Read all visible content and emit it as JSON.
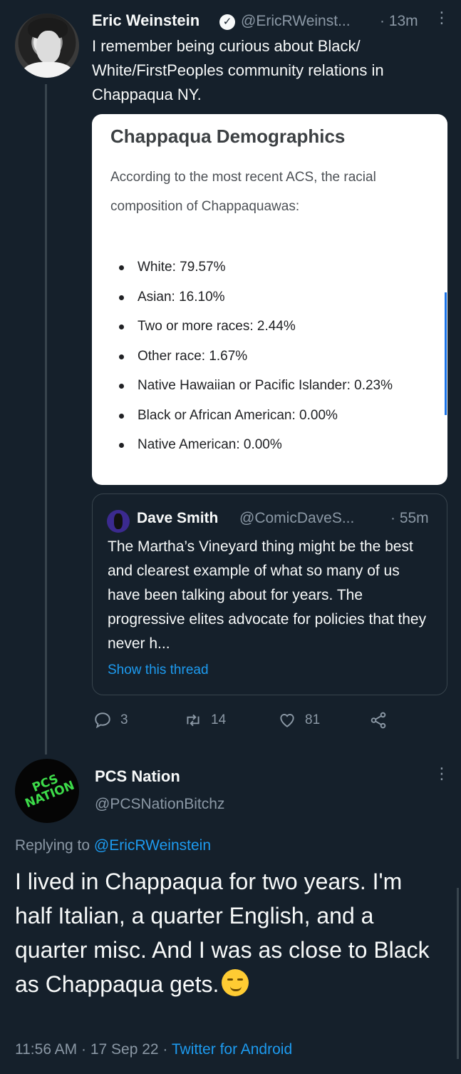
{
  "tweet1": {
    "author_name": "Eric Weinstein",
    "handle": "@EricRWeinst...",
    "time": "· 13m",
    "text": "I remember being curious about Black/ White/FirstPeoples community relations in Chappaqua NY.",
    "card": {
      "title": "Chappaqua Demographics",
      "description": "According to the most recent ACS, the racial composition of Chappaquawas:",
      "items": [
        "White: 79.57%",
        "Asian: 16.10%",
        "Two or more races: 2.44%",
        "Other race: 1.67%",
        "Native Hawaiian or Pacific Islander: 0.23%",
        "Black or African American: 0.00%",
        "Native American: 0.00%"
      ]
    },
    "quote": {
      "author_name": "Dave Smith",
      "handle": "@ComicDaveS...",
      "time": "· 55m",
      "text": "The Martha’s Vineyard thing might be the best and clearest example of what so many of us have been talking about for years. The progressive elites advocate for policies that they never h...",
      "link": "Show this thread"
    },
    "actions": {
      "replies": "3",
      "retweets": "14",
      "likes": "81"
    }
  },
  "tweet2": {
    "author_name": "PCS Nation",
    "handle": "@PCSNationBitchz",
    "avatar_logo_line1": "PCS",
    "avatar_logo_line2": "NATION",
    "replying_prefix": "Replying to",
    "replying_to": "@EricRWeinstein",
    "text": "I lived in Chappaqua for two years. I'm half Italian, a quarter English, and a quarter misc. And I was as close to Black as Chappaqua gets.",
    "emoji": "smirking-face",
    "timestamp": "11:56 AM · 17 Sep 22 ·",
    "client": "Twitter for Android"
  },
  "colors": {
    "background": "#15202b",
    "link": "#1d9bf0",
    "secondary_text": "#8b98a5",
    "brand_green": "#3ddc4a"
  }
}
